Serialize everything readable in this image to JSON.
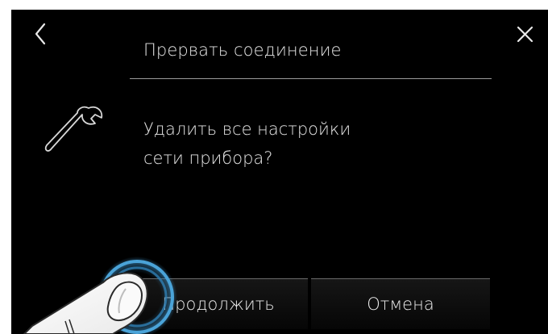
{
  "dialog": {
    "title": "Прервать соединение",
    "message_line1": "Удалить все настройки",
    "message_line2": "сети прибора?"
  },
  "buttons": {
    "continue_label": "Продолжить",
    "cancel_label": "Отмена"
  },
  "icons": {
    "back": "chevron-left-icon",
    "close": "close-icon",
    "settings": "wrench-icon",
    "touch": "finger-press-indicator"
  },
  "colors": {
    "background": "#000000",
    "text": "#e6e6e6",
    "touch_ring": "#4aa3d8"
  }
}
